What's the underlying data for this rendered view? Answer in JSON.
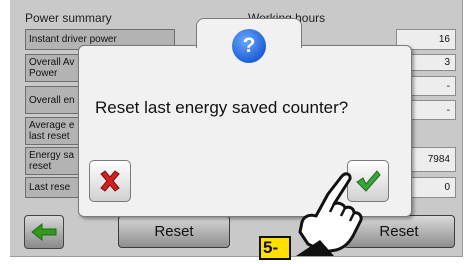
{
  "headers": {
    "power_summary": "Power summary",
    "working_hours": "Working hours"
  },
  "rows": [
    {
      "label": "Instant driver power",
      "value": "16"
    },
    {
      "label": "Overall Av\nPower",
      "value": "3"
    },
    {
      "label": "Overall en",
      "value": "-"
    },
    {
      "label": "Average e\nlast reset",
      "value": "-"
    },
    {
      "label": "Energy sa\nreset",
      "value": "7984"
    },
    {
      "label": "Last rese",
      "value": "0"
    }
  ],
  "buttons": {
    "reset_left": "Reset",
    "reset_right": "Reset"
  },
  "dialog": {
    "message": "Reset last energy saved counter?"
  },
  "annotation": {
    "step": "5-"
  },
  "icons": {
    "back": "back-arrow-icon",
    "question": "question-icon",
    "cancel": "cancel-x-icon",
    "confirm": "confirm-check-icon",
    "hand": "pointing-hand-icon"
  },
  "colors": {
    "back_arrow": "#2f9a1e",
    "cancel_x": "#d42020",
    "check": "#38a638",
    "question": "#1f5fd6",
    "step_badge": "#ffdf00"
  }
}
